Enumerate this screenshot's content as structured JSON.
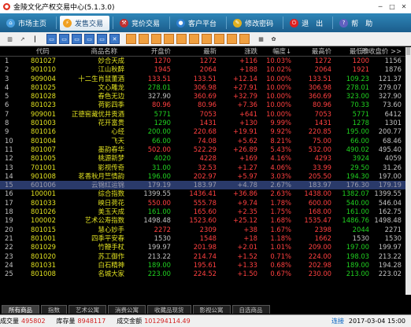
{
  "window": {
    "title": "金陵文化产权交易中心(5.1.3.0)"
  },
  "nav": [
    {
      "label": "市场主页",
      "icon": "home-icon",
      "active": false,
      "color": "#4aa0e0"
    },
    {
      "label": "发售交易",
      "icon": "lightning-icon",
      "active": true,
      "color": "#f0a020"
    },
    {
      "label": "竞价交易",
      "icon": "gavel-icon",
      "active": false,
      "color": "#c03030"
    },
    {
      "label": "客户平台",
      "icon": "user-icon",
      "active": false,
      "color": "#3080d0"
    },
    {
      "label": "修改密码",
      "icon": "key-icon",
      "active": false,
      "color": "#e0b020"
    },
    {
      "label": "退　出",
      "icon": "power-icon",
      "active": false,
      "color": "#e02020"
    },
    {
      "label": "帮　助",
      "icon": "help-icon",
      "active": false,
      "color": "#6060c0"
    }
  ],
  "toolbar": [
    "bar-chart-icon",
    "line-chart-icon",
    "candle-icon",
    "window-icon",
    "window-icon",
    "window-icon",
    "window-icon",
    "window-icon",
    "close-icon",
    "f1-icon",
    "f2-icon",
    "f3-icon",
    "f4-icon",
    "f5-icon",
    "f6-icon",
    "f7-icon",
    "f8-icon",
    "f9-icon",
    "f10-icon",
    "calc-icon",
    "gear-icon"
  ],
  "columns": {
    "code": "代码",
    "name": "商品名称",
    "open": "开盘价",
    "last": "最新",
    "chg": "涨跌",
    "pct": "幅度↓",
    "high": "最高价",
    "low": "最低价",
    "prev": "昨收盘价 >>"
  },
  "rows": [
    {
      "n": "1",
      "code": "801027",
      "name": "妙合天成",
      "open": "1270",
      "last": "1272",
      "chg": "+116",
      "pct": "10.03%",
      "high": "1272",
      "low": "1200",
      "prev": "1156",
      "oc": "r",
      "lc": "r",
      "hc": "r",
      "wc": "r"
    },
    {
      "n": "2",
      "code": "901010",
      "name": "江山秋醉",
      "open": "1945",
      "last": "2064",
      "chg": "+188",
      "pct": "10.02%",
      "high": "2064",
      "low": "1921",
      "prev": "1876",
      "oc": "r",
      "lc": "r",
      "hc": "r",
      "wc": "r"
    },
    {
      "n": "3",
      "code": "909004",
      "name": "十二生肖鼠董酒",
      "open": "133.51",
      "last": "133.51",
      "chg": "+12.14",
      "pct": "10.00%",
      "high": "133.51",
      "low": "109.23",
      "prev": "121.37",
      "oc": "r",
      "lc": "r",
      "hc": "r",
      "wc": "g"
    },
    {
      "n": "4",
      "code": "801025",
      "name": "文心雕龙",
      "open": "278.01",
      "last": "306.98",
      "chg": "+27.91",
      "pct": "10.00%",
      "high": "306.98",
      "low": "278.01",
      "prev": "279.07",
      "oc": "g",
      "lc": "r",
      "hc": "r",
      "wc": "g"
    },
    {
      "n": "5",
      "code": "801028",
      "name": "春色无边",
      "open": "327.90",
      "last": "360.69",
      "chg": "+32.79",
      "pct": "10.00%",
      "high": "360.69",
      "low": "323.00",
      "prev": "327.90",
      "oc": "w",
      "lc": "r",
      "hc": "r",
      "wc": "g"
    },
    {
      "n": "6",
      "code": "801023",
      "name": "荷影四季",
      "open": "80.96",
      "last": "80.96",
      "chg": "+7.36",
      "pct": "10.00%",
      "high": "80.96",
      "low": "70.33",
      "prev": "73.60",
      "oc": "r",
      "lc": "r",
      "hc": "r",
      "wc": "g"
    },
    {
      "n": "7",
      "code": "909001",
      "name": "正德窖藏优井贡酒",
      "open": "5771",
      "last": "7053",
      "chg": "+641",
      "pct": "10.00%",
      "high": "7053",
      "low": "5771",
      "prev": "6412",
      "oc": "g",
      "lc": "r",
      "hc": "r",
      "wc": "g"
    },
    {
      "n": "8",
      "code": "801003",
      "name": "花开富贵",
      "open": "1290",
      "last": "1431",
      "chg": "+130",
      "pct": "9.99%",
      "high": "1431",
      "low": "1278",
      "prev": "1301",
      "oc": "g",
      "lc": "r",
      "hc": "r",
      "wc": "g"
    },
    {
      "n": "9",
      "code": "801016",
      "name": "心经",
      "open": "200.00",
      "last": "220.68",
      "chg": "+19.91",
      "pct": "9.92%",
      "high": "220.85",
      "low": "195.00",
      "prev": "200.77",
      "oc": "g",
      "lc": "r",
      "hc": "r",
      "wc": "g"
    },
    {
      "n": "10",
      "code": "801004",
      "name": "飞天",
      "open": "66.00",
      "last": "74.08",
      "chg": "+5.62",
      "pct": "8.21%",
      "high": "75.00",
      "low": "66.00",
      "prev": "68.46",
      "oc": "g",
      "lc": "r",
      "hc": "r",
      "wc": "g"
    },
    {
      "n": "11",
      "code": "801007",
      "name": "墨韵春华",
      "open": "502.00",
      "last": "522.29",
      "chg": "+26.89",
      "pct": "5.43%",
      "high": "532.00",
      "low": "490.02",
      "prev": "495.40",
      "oc": "r",
      "lc": "r",
      "hc": "r",
      "wc": "g"
    },
    {
      "n": "12",
      "code": "801005",
      "name": "桃源新梦",
      "open": "4020",
      "last": "4228",
      "chg": "+169",
      "pct": "4.16%",
      "high": "4293",
      "low": "3924",
      "prev": "4059",
      "oc": "g",
      "lc": "r",
      "hc": "r",
      "wc": "g"
    },
    {
      "n": "13",
      "code": "701001",
      "name": "影视传奇",
      "open": "31.00",
      "last": "32.53",
      "chg": "+1.27",
      "pct": "4.06%",
      "high": "33.99",
      "low": "29.50",
      "prev": "31.26",
      "oc": "g",
      "lc": "r",
      "hc": "r",
      "wc": "g"
    },
    {
      "n": "14",
      "code": "901008",
      "name": "茗香秋月竺情韵",
      "open": "196.00",
      "last": "202.97",
      "chg": "+5.97",
      "pct": "3.03%",
      "high": "205.50",
      "low": "194.30",
      "prev": "197.00",
      "oc": "g",
      "lc": "r",
      "hc": "r",
      "wc": "g"
    },
    {
      "n": "15",
      "code": "601006",
      "name": "云锦红运锦",
      "open": "179.19",
      "last": "183.97",
      "chg": "+4.78",
      "pct": "2.67%",
      "high": "183.97",
      "low": "176.30",
      "prev": "179.19",
      "oc": "w",
      "lc": "r",
      "hc": "r",
      "wc": "g",
      "sel": true
    },
    {
      "n": "16",
      "code": "100001",
      "name": "综合指数",
      "open": "1399.55",
      "last": "1436.41",
      "chg": "+36.86",
      "pct": "2.63%",
      "high": "1438.00",
      "low": "1382.07",
      "prev": "1399.55",
      "oc": "w",
      "lc": "r",
      "hc": "r",
      "wc": "g"
    },
    {
      "n": "17",
      "code": "801033",
      "name": "映日荷花",
      "open": "550.00",
      "last": "555.78",
      "chg": "+9.74",
      "pct": "1.78%",
      "high": "600.00",
      "low": "540.00",
      "prev": "546.04",
      "oc": "r",
      "lc": "r",
      "hc": "r",
      "wc": "g"
    },
    {
      "n": "18",
      "code": "801026",
      "name": "美玉天成",
      "open": "161.00",
      "last": "165.60",
      "chg": "+2.35",
      "pct": "1.75%",
      "high": "168.00",
      "low": "161.00",
      "prev": "162.75",
      "oc": "g",
      "lc": "r",
      "hc": "r",
      "wc": "g"
    },
    {
      "n": "19",
      "code": "100002",
      "name": "艺术公寿指数",
      "open": "1498.48",
      "last": "1523.60",
      "chg": "+25.12",
      "pct": "1.68%",
      "high": "1535.47",
      "low": "1486.76",
      "prev": "1498.48",
      "oc": "w",
      "lc": "r",
      "hc": "r",
      "wc": "g"
    },
    {
      "n": "20",
      "code": "801015",
      "name": "慧心妙手",
      "open": "2272",
      "last": "2309",
      "chg": "+38",
      "pct": "1.67%",
      "high": "2398",
      "low": "2044",
      "prev": "2271",
      "oc": "r",
      "lc": "r",
      "hc": "r",
      "wc": "g"
    },
    {
      "n": "21",
      "code": "801001",
      "name": "四季平安春",
      "open": "1530",
      "last": "1548",
      "chg": "+18",
      "pct": "1.18%",
      "high": "1662",
      "low": "1530",
      "prev": "1530",
      "oc": "w",
      "lc": "r",
      "hc": "r",
      "wc": "w"
    },
    {
      "n": "22",
      "code": "801029",
      "name": "竹鞭手杖",
      "open": "199.97",
      "last": "201.98",
      "chg": "+2.01",
      "pct": "1.01%",
      "high": "209.00",
      "low": "197.00",
      "prev": "199.97",
      "oc": "w",
      "lc": "r",
      "hc": "r",
      "wc": "g"
    },
    {
      "n": "23",
      "code": "801020",
      "name": "苏工御作",
      "open": "213.22",
      "last": "214.74",
      "chg": "+1.52",
      "pct": "0.71%",
      "high": "224.00",
      "low": "198.03",
      "prev": "213.22",
      "oc": "w",
      "lc": "r",
      "hc": "r",
      "wc": "g"
    },
    {
      "n": "24",
      "code": "801031",
      "name": "白石精神",
      "open": "189.00",
      "last": "195.61",
      "chg": "+1.33",
      "pct": "0.68%",
      "high": "202.98",
      "low": "189.00",
      "prev": "194.28",
      "oc": "g",
      "lc": "r",
      "hc": "r",
      "wc": "g"
    },
    {
      "n": "25",
      "code": "801008",
      "name": "名城大家",
      "open": "223.00",
      "last": "224.52",
      "chg": "+1.50",
      "pct": "0.67%",
      "high": "230.00",
      "low": "213.00",
      "prev": "223.02",
      "oc": "g",
      "lc": "r",
      "hc": "r",
      "wc": "g"
    }
  ],
  "tabs": [
    {
      "label": "所有商品",
      "active": true
    },
    {
      "label": "指数",
      "active": false
    },
    {
      "label": "艺术公寓",
      "active": false
    },
    {
      "label": "消费公寓",
      "active": false
    },
    {
      "label": "收藏品现货",
      "active": false
    },
    {
      "label": "影视公寓",
      "active": false
    },
    {
      "label": "自选商品",
      "active": false
    }
  ],
  "status": {
    "volume_label": "成交量",
    "volume_value": "495802",
    "stock_label": "库存量",
    "stock_value": "8948117",
    "amount_label": "成交金额",
    "amount_value": "101294114.49",
    "conn": "连接",
    "time": "2017-03-04 15:00"
  },
  "colors": {
    "red": "#ff4040",
    "green": "#20d020",
    "yellow": "#e0e020",
    "white": "#c0c0c0",
    "selected": "#2a3a6a"
  }
}
